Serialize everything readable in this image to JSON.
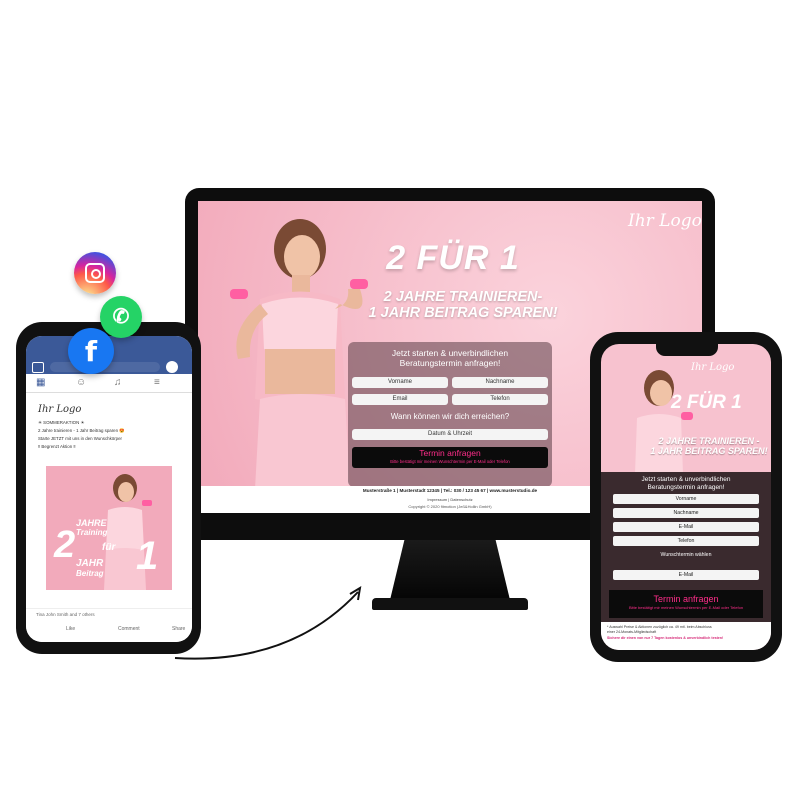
{
  "desktop": {
    "logo": "Ihr Logo",
    "headline": "2 FÜR 1",
    "subheadline_line1": "2 JAHRE TRAINIEREN-",
    "subheadline_line2": "1 JAHR BEITRAG SPAREN!",
    "form_title_line1": "Jetzt starten & unverbindlichen",
    "form_title_line2": "Beratungstermin anfragen!",
    "fields": {
      "vorname": "Vorname",
      "nachname": "Nachname",
      "email": "Email",
      "telefon": "Telefon",
      "datum": "Datum & Uhrzeit"
    },
    "question": "Wann können wir dich erreichen?",
    "cta": "Termin anfragen",
    "cta_note": "Bitte bestätigt mir meinen Wunschtermin per E-Mail oder Telefon",
    "footer_line": "Musterstraße 1 | Musterstadt 12345 | Tel.: 030 / 123 45 67 | www.musterstudio.de",
    "footer_links": "Impressum | Datenschutz",
    "footer_copy": "Copyright © 2020 fitmotion (Jeß&Hollin GmbH)"
  },
  "facebook_phone": {
    "logo": "Ihr Logo",
    "post_lines": [
      "☀ SOMMERAKTION ☀",
      "2 Jahre trainieren - 1 Jahr Beitrag sparen 😍",
      "Starte JETZT mit uns in den Wunschkörper",
      "‼ Begrenzt Aktion ‼"
    ],
    "graphic_big_left": "2",
    "graphic_big_right": "1",
    "graphic_text_1": "JAHRE",
    "graphic_text_2": "Training",
    "graphic_text_3": "für",
    "graphic_text_4": "JAHR",
    "graphic_text_5": "Beitrag",
    "likes": "Tina John Smith and 7 others",
    "like": "Like",
    "comment": "Comment",
    "share": "Share"
  },
  "mobile_phone": {
    "logo": "Ihr Logo",
    "headline": "2 FÜR 1",
    "sub_line1": "2 JAHRE TRAINIEREN -",
    "sub_line2": "1 JAHR BEITRAG SPAREN!",
    "form_title_line1": "Jetzt starten & unverbindlichen",
    "form_title_line2": "Beratungstermin anfragen!",
    "fields": [
      "Vorname",
      "Nachname",
      "E-Mail",
      "Telefon"
    ],
    "wunsch": "Wunschtermin wählen",
    "email2": "E-Mail",
    "cta": "Termin anfragen",
    "cta_note": "Bitte bestätigt mir meinen Wunschtermin per E-Mail oder Telefon",
    "foot_1": "* Auswahl Preise & Aktionen zuzüglich ca. 49 mtl. beim Abschluss",
    "foot_2": "einer 24-Monats-Mitgliedschaft",
    "foot_3": "Sichere dir einen von nur 7 Tagen kostenlos & unverbindlich testen!"
  },
  "social": {
    "instagram": "instagram-icon",
    "whatsapp": "whatsapp-icon",
    "facebook": "facebook-icon",
    "facebook_glyph": "f"
  },
  "colors": {
    "pink": "#f7c2cf",
    "cta_pink": "#ff2d8a",
    "facebook_blue": "#3b5998"
  }
}
